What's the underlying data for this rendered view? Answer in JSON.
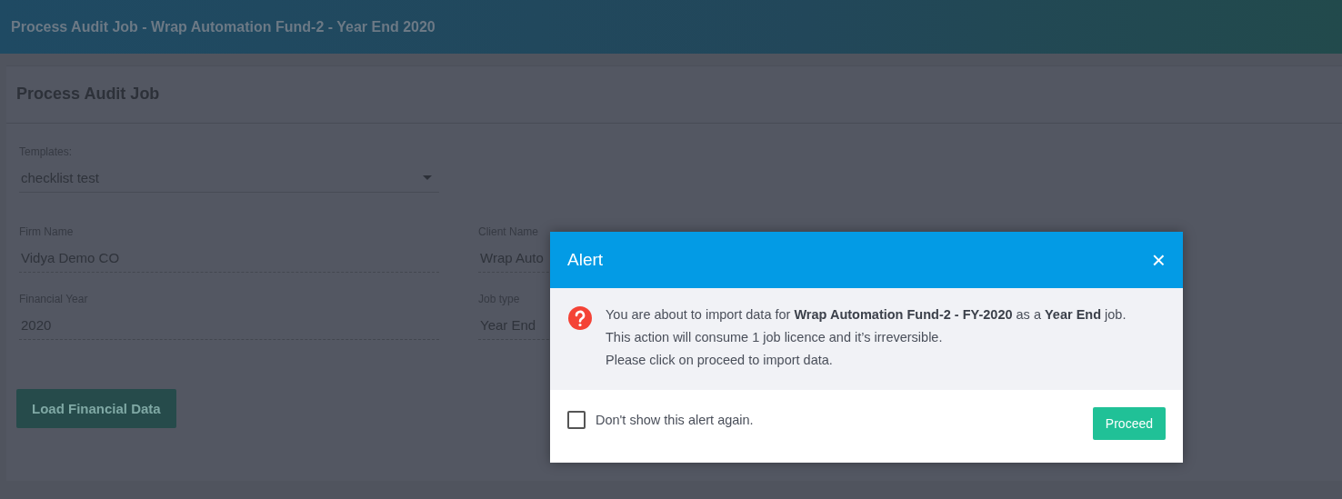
{
  "header": {
    "title": "Process Audit Job - Wrap Automation Fund-2 - Year End 2020"
  },
  "card": {
    "title": "Process Audit Job",
    "template": {
      "label": "Templates:",
      "value": "checklist test"
    },
    "fields": [
      {
        "label": "Firm Name",
        "value": "Vidya Demo CO"
      },
      {
        "label": "Client Name",
        "value": "Wrap Auto"
      },
      {
        "label": "Financial Year",
        "value": "2020"
      },
      {
        "label": "Job type",
        "value": "Year End"
      }
    ],
    "button": "Load Financial Data"
  },
  "dialog": {
    "title": "Alert",
    "close": "×",
    "message": [
      "You are about to import data for **Wrap Automation Fund-2 - FY-2020** as a **Year End** job.",
      "This action will consume 1 job licence and it’s irreversible.",
      "Please click on proceed to import data."
    ],
    "checkbox": {
      "label": "Don't show this alert again.",
      "checked": false
    },
    "button": "Proceed"
  }
}
